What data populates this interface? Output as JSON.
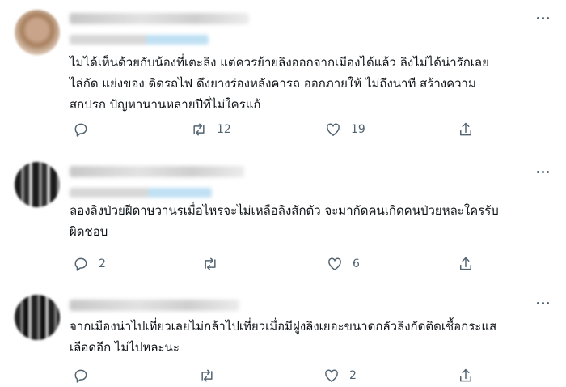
{
  "tweets": [
    {
      "text": "ไม่ได้เห็นด้วยกับน้องที่เตะลิง แต่ควรย้ายลิงออกจากเมืองได้แล้ว ลิงไม่ได้น่ารักเลย\nไล่กัด แย่งของ ดิดรถไฟ ดึงยางร่องหลังคารถ ออกภายให้ ไม่ถึงนาที สร้างความ\nสกปรก ปัญหานานหลายปีที่ไม่ใครแก้",
      "reply_count": "",
      "retweet_count": "12",
      "like_count": "19"
    },
    {
      "text": "ลองลิงป่วยฝีดาษวานรเมื่อไหร่จะไม่เหลือลิงสักตัว จะมากัดคนเกิดคนป่วยหละใครรับ\nผิดชอบ",
      "reply_count": "2",
      "retweet_count": "",
      "like_count": "6"
    },
    {
      "text": "จากเมืองน่าไปเที่ยวเลยไม่กล้าไปเที่ยวเมื่อมีฝูงลิงเยอะขนาดกลัวลิงกัดติดเชื้อกระแส\nเลือดอีก ไม่ไปหละนะ",
      "reply_count": "",
      "retweet_count": "",
      "like_count": "2"
    }
  ],
  "icons": {
    "reply": "reply-icon",
    "retweet": "retweet-icon",
    "like": "heart-icon",
    "share": "share-icon",
    "more": "more-options-icon"
  },
  "colors": {
    "icon": "#536471",
    "text": "#0f1419",
    "divider": "#e6ecf0"
  }
}
